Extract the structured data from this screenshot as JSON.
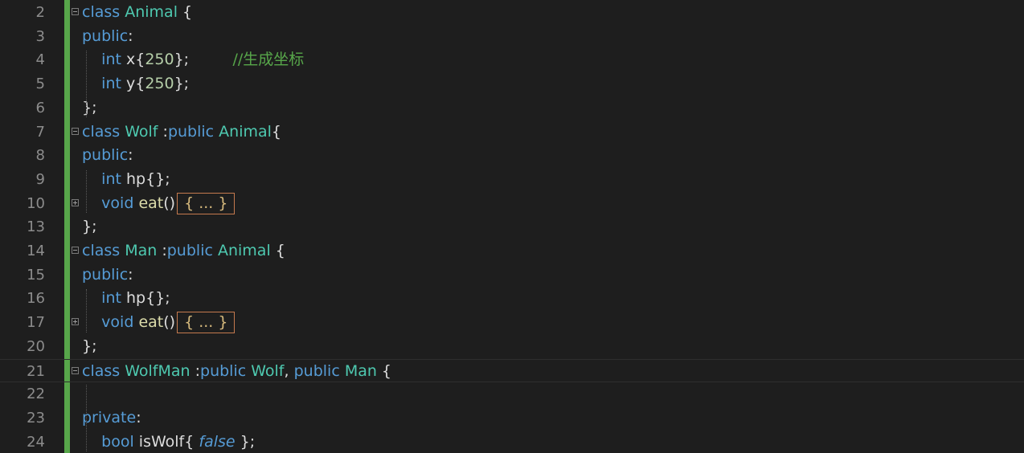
{
  "editor": {
    "lines": [
      {
        "number": "2",
        "fold": "minus",
        "tokens": [
          {
            "t": "class",
            "c": "kw"
          },
          {
            "t": " "
          },
          {
            "t": "Animal",
            "c": "ty"
          },
          {
            "t": " {"
          }
        ]
      },
      {
        "number": "3",
        "fold": "",
        "tokens": [
          {
            "t": "public",
            "c": "kw"
          },
          {
            "t": ":"
          }
        ]
      },
      {
        "number": "4",
        "fold": "",
        "tokens": [
          {
            "t": "    "
          },
          {
            "t": "int",
            "c": "kw"
          },
          {
            "t": " x{"
          },
          {
            "t": "250",
            "c": "num"
          },
          {
            "t": "};         "
          },
          {
            "t": "//生成坐标",
            "c": "cm"
          }
        ]
      },
      {
        "number": "5",
        "fold": "",
        "tokens": [
          {
            "t": "    "
          },
          {
            "t": "int",
            "c": "kw"
          },
          {
            "t": " y{"
          },
          {
            "t": "250",
            "c": "num"
          },
          {
            "t": "};"
          }
        ]
      },
      {
        "number": "6",
        "fold": "",
        "tokens": [
          {
            "t": "};"
          }
        ]
      },
      {
        "number": "7",
        "fold": "minus",
        "tokens": [
          {
            "t": "class",
            "c": "kw"
          },
          {
            "t": " "
          },
          {
            "t": "Wolf",
            "c": "ty"
          },
          {
            "t": " :"
          },
          {
            "t": "public",
            "c": "kw"
          },
          {
            "t": " "
          },
          {
            "t": "Animal",
            "c": "ty"
          },
          {
            "t": "{"
          }
        ]
      },
      {
        "number": "8",
        "fold": "",
        "tokens": [
          {
            "t": "public",
            "c": "kw"
          },
          {
            "t": ":"
          }
        ]
      },
      {
        "number": "9",
        "fold": "",
        "tokens": [
          {
            "t": "    "
          },
          {
            "t": "int",
            "c": "kw"
          },
          {
            "t": " hp{};"
          }
        ]
      },
      {
        "number": "10",
        "fold": "plus",
        "tokens": [
          {
            "t": "    "
          },
          {
            "t": "void",
            "c": "kw"
          },
          {
            "t": " "
          },
          {
            "t": "eat",
            "c": "fn"
          },
          {
            "t": "()"
          }
        ],
        "collapsed": "{ ... }"
      },
      {
        "number": "13",
        "fold": "",
        "tokens": [
          {
            "t": "};"
          }
        ]
      },
      {
        "number": "14",
        "fold": "minus",
        "tokens": [
          {
            "t": "class",
            "c": "kw"
          },
          {
            "t": " "
          },
          {
            "t": "Man",
            "c": "ty"
          },
          {
            "t": " :"
          },
          {
            "t": "public",
            "c": "kw"
          },
          {
            "t": " "
          },
          {
            "t": "Animal",
            "c": "ty"
          },
          {
            "t": " {"
          }
        ]
      },
      {
        "number": "15",
        "fold": "",
        "tokens": [
          {
            "t": "public",
            "c": "kw"
          },
          {
            "t": ":"
          }
        ]
      },
      {
        "number": "16",
        "fold": "",
        "tokens": [
          {
            "t": "    "
          },
          {
            "t": "int",
            "c": "kw"
          },
          {
            "t": " hp{};"
          }
        ]
      },
      {
        "number": "17",
        "fold": "plus",
        "tokens": [
          {
            "t": "    "
          },
          {
            "t": "void",
            "c": "kw"
          },
          {
            "t": " "
          },
          {
            "t": "eat",
            "c": "fn"
          },
          {
            "t": "()"
          }
        ],
        "collapsed": "{ ... }"
      },
      {
        "number": "20",
        "fold": "",
        "tokens": [
          {
            "t": "};"
          }
        ]
      },
      {
        "number": "21",
        "fold": "minus",
        "current": true,
        "tokens": [
          {
            "t": "class",
            "c": "kw"
          },
          {
            "t": " "
          },
          {
            "t": "WolfMan",
            "c": "ty"
          },
          {
            "t": " :"
          },
          {
            "t": "public",
            "c": "kw"
          },
          {
            "t": " "
          },
          {
            "t": "Wolf",
            "c": "ty"
          },
          {
            "t": ", "
          },
          {
            "t": "public",
            "c": "kw"
          },
          {
            "t": " "
          },
          {
            "t": "Man",
            "c": "ty"
          },
          {
            "t": " {"
          }
        ]
      },
      {
        "number": "22",
        "fold": "",
        "tokens": []
      },
      {
        "number": "23",
        "fold": "",
        "tokens": [
          {
            "t": "private",
            "c": "kw"
          },
          {
            "t": ":"
          }
        ]
      },
      {
        "number": "24",
        "fold": "",
        "tokens": [
          {
            "t": "    "
          },
          {
            "t": "bool",
            "c": "kw"
          },
          {
            "t": " isWolf{ "
          },
          {
            "t": "false",
            "c": "lit"
          },
          {
            "t": " };"
          }
        ]
      }
    ]
  },
  "colors": {
    "background": "#1e1e1e",
    "keyword": "#569cd6",
    "type": "#4ec9b0",
    "number": "#b5cea8",
    "function": "#dcdcaa",
    "comment": "#57a64a",
    "change_bar": "#57a64a"
  }
}
